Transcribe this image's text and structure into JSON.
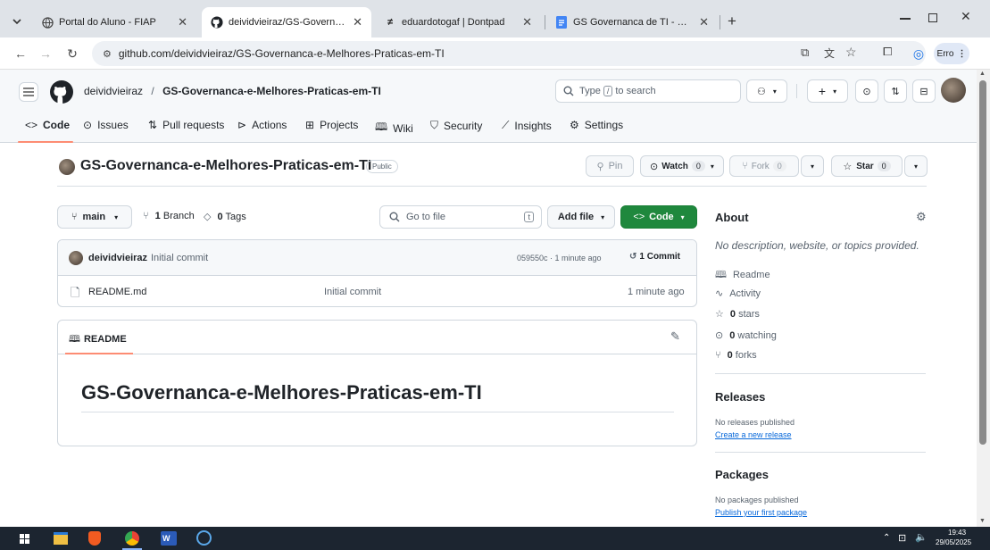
{
  "tabs": [
    {
      "title": "Portal do Aluno - FIAP"
    },
    {
      "title": "deividvieiraz/GS-Governanca-e-"
    },
    {
      "title": "eduardotogaf | Dontpad"
    },
    {
      "title": "GS Governanca de TI - Google D"
    }
  ],
  "toolbar": {
    "url": "github.com/deividvieiraz/GS-Governanca-e-Melhores-Praticas-em-TI",
    "profile_label": "Erro"
  },
  "header": {
    "owner": "deividvieiraz",
    "separator": "/",
    "repo": "GS-Governanca-e-Melhores-Praticas-em-TI",
    "search_prefix": "Type",
    "search_key": "/",
    "search_suffix": "to search"
  },
  "nav": [
    {
      "label": "Code"
    },
    {
      "label": "Issues"
    },
    {
      "label": "Pull requests"
    },
    {
      "label": "Actions"
    },
    {
      "label": "Projects"
    },
    {
      "label": "Wiki"
    },
    {
      "label": "Security"
    },
    {
      "label": "Insights"
    },
    {
      "label": "Settings"
    }
  ],
  "repo": {
    "name": "GS-Governanca-e-Melhores-Praticas-em-TI",
    "visibility": "Public",
    "pin_label": "Pin",
    "watch_label": "Watch",
    "watch_count": "0",
    "fork_label": "Fork",
    "fork_count": "0",
    "star_label": "Star",
    "star_count": "0"
  },
  "filebar": {
    "branch": "main",
    "branches_count": "1",
    "branches_label": "Branch",
    "tags_count": "0",
    "tags_label": "Tags",
    "goto_placeholder": "Go to file",
    "goto_key": "t",
    "add_file_label": "Add file",
    "code_label": "Code"
  },
  "commit": {
    "author": "deividvieiraz",
    "message": "Initial commit",
    "hash_time": "059550c · 1 minute ago",
    "count_label": "1 Commit"
  },
  "files": [
    {
      "name": "README.md",
      "message": "Initial commit",
      "time": "1 minute ago"
    }
  ],
  "readme": {
    "tab_label": "README",
    "heading": "GS-Governanca-e-Melhores-Praticas-em-TI"
  },
  "about": {
    "title": "About",
    "description": "No description, website, or topics provided.",
    "readme": "Readme",
    "activity": "Activity",
    "stars_count": "0",
    "stars_label": "stars",
    "watching_count": "0",
    "watching_label": "watching",
    "forks_count": "0",
    "forks_label": "forks"
  },
  "releases": {
    "title": "Releases",
    "empty": "No releases published",
    "link": "Create a new release"
  },
  "packages": {
    "title": "Packages",
    "empty": "No packages published",
    "link": "Publish your first package"
  },
  "taskbar": {
    "time": "19:43",
    "date": "29/05/2025"
  },
  "colors": {
    "accent_green": "#1f883d",
    "link_blue": "#0969da",
    "tabstrip": "#dfe3e8",
    "taskbar": "#1c2530"
  }
}
